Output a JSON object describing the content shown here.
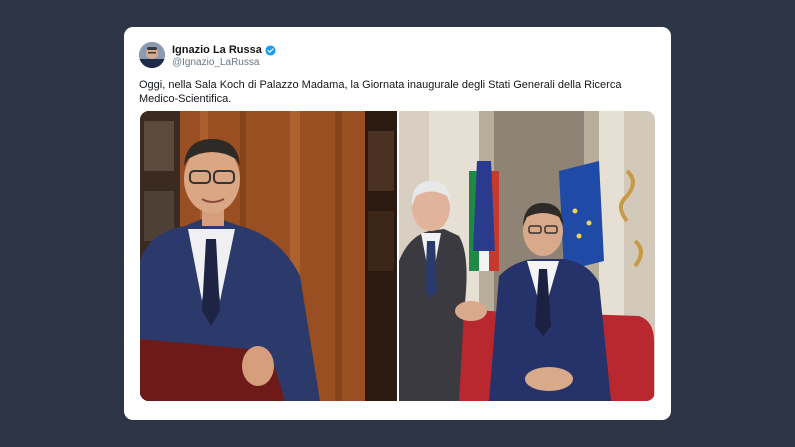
{
  "tweet": {
    "author_name": "Ignazio La Russa",
    "author_handle": "@Ignazio_LaRussa",
    "verified": true,
    "text": "Oggi, nella Sala Koch di Palazzo Madama, la Giornata inaugurale degli Stati Generali della Ricerca Medico-Scientifica.",
    "media": [
      {
        "icon": "photo-speaker-at-podium"
      },
      {
        "icon": "photo-two-men-meeting-with-flags"
      }
    ]
  },
  "colors": {
    "background": "#2e3546",
    "card": "#ffffff",
    "verified_badge": "#1d9bf0",
    "text_primary": "#14171a",
    "text_secondary": "#657786"
  }
}
